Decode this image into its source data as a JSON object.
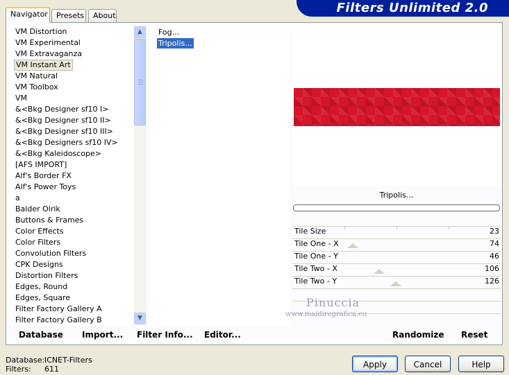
{
  "title": "Filters Unlimited 2.0",
  "tabs": [
    {
      "label": "Navigator",
      "active": true
    },
    {
      "label": "Presets"
    },
    {
      "label": "About"
    }
  ],
  "categories": [
    "VM Distortion",
    "VM Experimental",
    "VM Extravaganza",
    "VM Instant Art",
    "VM Natural",
    "VM Toolbox",
    "VM",
    "&<Bkg Designer sf10 I>",
    "&<Bkg Designer sf10 II>",
    "&<Bkg Designer sf10 III>",
    "&<Bkg Designers sf10 IV>",
    "&<Bkg Kaleidoscope>",
    "[AFS IMPORT]",
    "Alf's Border FX",
    "Alf's Power Toys",
    "a",
    "Balder Olrik",
    "Buttons & Frames",
    "Color Effects",
    "Color Filters",
    "Convolution Filters",
    "CPK Designs",
    "Distortion Filters",
    "Edges, Round",
    "Edges, Square",
    "Filter Factory Gallery A",
    "Filter Factory Gallery B"
  ],
  "selected_category": "VM Instant Art",
  "filters": [
    "Fog...",
    "Tripolis..."
  ],
  "selected_filter": "Tripolis...",
  "preview_color": "#D4152A",
  "current_filter_name": "Tripolis...",
  "params": [
    {
      "label": "Tile Size",
      "value": "23"
    },
    {
      "label": "Tile One - X",
      "value": "74"
    },
    {
      "label": "Tile One - Y",
      "value": "46"
    },
    {
      "label": "Tile Two - X",
      "value": "106"
    },
    {
      "label": "Tile Two - Y",
      "value": "126"
    }
  ],
  "watermark": {
    "name": "Pinuccia",
    "url": "www.maidiregrafica.eu"
  },
  "actions": {
    "database": "Database",
    "import": "Import...",
    "filter_info": "Filter Info...",
    "editor": "Editor...",
    "randomize": "Randomize",
    "reset": "Reset"
  },
  "footer": {
    "database_label": "Database:",
    "database_value": "ICNET-Filters",
    "filters_label": "Filters:",
    "filters_value": "611"
  },
  "buttons": {
    "apply": "Apply",
    "cancel": "Cancel",
    "help": "Help"
  }
}
